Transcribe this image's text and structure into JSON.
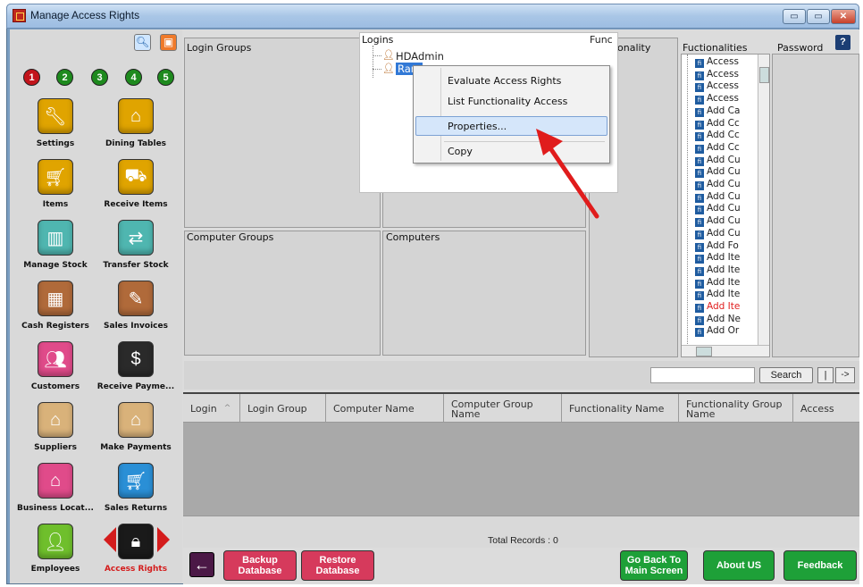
{
  "window": {
    "title": "Manage Access Rights",
    "minimize": "▭",
    "restore": "▭",
    "close": "✕"
  },
  "left_panel": {
    "numbers": [
      "1",
      "2",
      "3",
      "4",
      "5"
    ],
    "tiles": [
      {
        "label": "Settings",
        "icon": "settings-icon",
        "color": "#e0a400"
      },
      {
        "label": "Dining Tables",
        "icon": "dining-tables-icon",
        "color": "#e0a400"
      },
      {
        "label": "Items",
        "icon": "shopping-cart-icon",
        "color": "#e0a400"
      },
      {
        "label": "Receive Items",
        "icon": "truck-icon",
        "color": "#e0a400"
      },
      {
        "label": "Manage Stock",
        "icon": "stock-icon",
        "color": "#4fb6b0"
      },
      {
        "label": "Transfer Stock",
        "icon": "transfer-icon",
        "color": "#4fb6b0"
      },
      {
        "label": "Cash Registers",
        "icon": "cash-register-icon",
        "color": "#b06a3a"
      },
      {
        "label": "Sales Invoices",
        "icon": "invoice-icon",
        "color": "#b06a3a"
      },
      {
        "label": "Customers",
        "icon": "customers-icon",
        "color": "#e04b8a"
      },
      {
        "label": "Receive Payme...",
        "icon": "receive-payment-icon",
        "color": "#2a2a2a"
      },
      {
        "label": "Suppliers",
        "icon": "factory-icon",
        "color": "#d9b27a"
      },
      {
        "label": "Make Payments",
        "icon": "payment-factory-icon",
        "color": "#d9b27a"
      },
      {
        "label": "Business Locat...",
        "icon": "location-icon",
        "color": "#e04b8a"
      },
      {
        "label": "Sales Returns",
        "icon": "sales-returns-icon",
        "color": "#2a8fd6"
      },
      {
        "label": "Employees",
        "icon": "employee-icon",
        "color": "#6fbf2c"
      },
      {
        "label": "Access Rights",
        "icon": "lock-icon",
        "color": "#1a1a1a"
      }
    ]
  },
  "panels": {
    "login_groups": "Login Groups",
    "computer_groups": "Computer Groups",
    "computers": "Computers",
    "func_truncated": "Func",
    "functionality_suffix": "onality",
    "fuctionalities": "Fuctionalities",
    "password": "Password",
    "help": "?"
  },
  "logins": {
    "title": "Logins",
    "items": [
      "HDAdmin",
      "Ram"
    ]
  },
  "context_menu": {
    "items": [
      "Evaluate Access Rights",
      "List Functionality Access",
      "Properties...",
      "Copy"
    ]
  },
  "functionalities": [
    "Access",
    "Access",
    "Access",
    "Access",
    "Add Ca",
    "Add Cc",
    "Add Cc",
    "Add Cc",
    "Add Cu",
    "Add Cu",
    "Add Cu",
    "Add Cu",
    "Add Cu",
    "Add Cu",
    "Add Cu",
    "Add Fo",
    "Add Ite",
    "Add Ite",
    "Add Ite",
    "Add Ite",
    "Add Ite",
    "Add Ne",
    "Add Or"
  ],
  "search": {
    "value": "",
    "button": "Search",
    "nav1": "|",
    "nav2": "->"
  },
  "grid": {
    "columns": [
      "Login",
      "Login Group",
      "Computer Name",
      "Computer Group Name",
      "Functionality Name",
      "Functionality Group Name",
      "Access"
    ],
    "total": "Total Records : 0"
  },
  "bottom": {
    "back_icon": "←",
    "backup": "Backup Database",
    "restore": "Restore Database",
    "go_back": "Go Back To Main Screen",
    "about": "About US",
    "feedback": "Feedback"
  }
}
